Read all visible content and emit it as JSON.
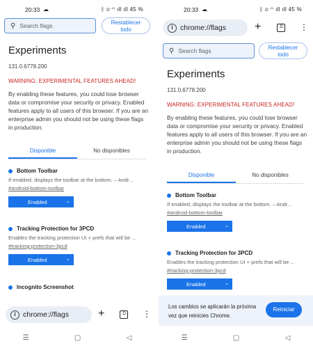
{
  "status": {
    "time": "20:33",
    "battery": "45 %",
    "signal_icons": "ᛒ ⊘ ⌔ ıll ıll"
  },
  "search": {
    "placeholder": "Search flags",
    "icon": "search-icon"
  },
  "reset_label_line1": "Restablecer",
  "reset_label_line2": "todo",
  "page": {
    "title": "Experiments",
    "version": "131.0.6778.200",
    "warning": "WARNING: EXPERIMENTAL FEATURES AHEAD!",
    "description": "By enabling these features, you could lose browser data or compromise your security or privacy. Enabled features apply to all users of this browser. If you are an enterprise admin you should not be using these flags in production."
  },
  "tabs": [
    {
      "label": "Disponible",
      "active": true
    },
    {
      "label": "No disponibles",
      "active": false
    }
  ],
  "flags": [
    {
      "title": "Bottom Toolbar",
      "description": "If enabled, displays the toolbar at the bottom. – Andr...",
      "link": "#android-bottom-toolbar",
      "state": "Enabled"
    },
    {
      "title": "Tracking Protection for 3PCD",
      "description": "Enables the tracking protection UI + prefs that will be ...",
      "link": "#tracking-protection-3pcd",
      "state": "Enabled"
    },
    {
      "title": "Incognito Screenshot"
    }
  ],
  "toolbar": {
    "url": "chrome://flags",
    "tab_count": ":D",
    "info_glyph": "i",
    "plus_glyph": "+",
    "menu_glyph": "⋮"
  },
  "restart": {
    "message": "Los cambios se aplicarán la próxima vez que reinicies Chrome.",
    "button": "Reiniciar"
  },
  "nav": {
    "recents": "☰",
    "home": "▢",
    "back": "◁"
  },
  "colors": {
    "accent": "#1a73e8",
    "warning": "#c5221f",
    "pill": "#e9eef6"
  }
}
